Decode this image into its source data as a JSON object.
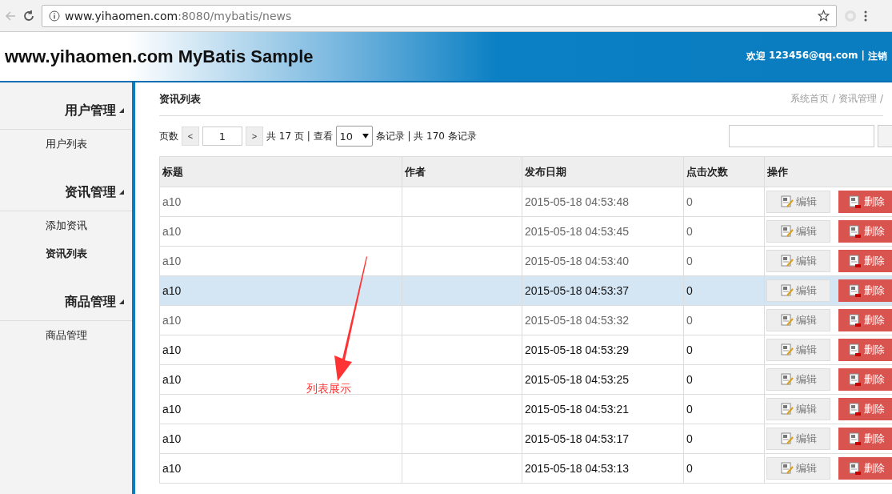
{
  "browser": {
    "url_host": "www.yihaomen.com",
    "url_rest": ":8080/mybatis/news"
  },
  "header": {
    "title": "www.yihaomen.com MyBatis Sample",
    "welcome": "欢迎",
    "user": "123456@qq.com",
    "separator": "|",
    "logout": "注销"
  },
  "sidebar": {
    "groups": [
      {
        "label": "用户管理",
        "expanded": true,
        "items": [
          {
            "label": "用户列表",
            "selected": false
          }
        ]
      },
      {
        "label": "资讯管理",
        "expanded": true,
        "items": [
          {
            "label": "添加资讯",
            "selected": false
          },
          {
            "label": "资讯列表",
            "selected": true
          }
        ]
      },
      {
        "label": "商品管理",
        "expanded": true,
        "items": [
          {
            "label": "商品管理",
            "selected": false
          }
        ]
      }
    ]
  },
  "page": {
    "title": "资讯列表",
    "breadcrumb": "系统首页 / 资讯管理 /"
  },
  "pager": {
    "label": "页数",
    "prev": "<",
    "page": "1",
    "next": ">",
    "pages_text": "共 17 页 | 查看",
    "page_size": "10",
    "records_text": "条记录 | 共 170 条记录"
  },
  "table": {
    "columns": [
      "标题",
      "作者",
      "发布日期",
      "点击次数",
      "操作"
    ],
    "rows": [
      {
        "title": "a10",
        "date": "2015-05-18 04:53:48",
        "clicks": "0",
        "dim": true,
        "selected": false,
        "edit": "编辑",
        "delete": "删除"
      },
      {
        "title": "a10",
        "date": "2015-05-18 04:53:45",
        "clicks": "0",
        "dim": true,
        "selected": false,
        "edit": "编辑",
        "delete": "删除"
      },
      {
        "title": "a10",
        "date": "2015-05-18 04:53:40",
        "clicks": "0",
        "dim": true,
        "selected": false,
        "edit": "编辑",
        "delete": "删除"
      },
      {
        "title": "a10",
        "date": "2015-05-18 04:53:37",
        "clicks": "0",
        "dim": false,
        "selected": true,
        "edit": "编辑",
        "delete": "删除"
      },
      {
        "title": "a10",
        "date": "2015-05-18 04:53:32",
        "clicks": "0",
        "dim": true,
        "selected": false,
        "edit": "编辑",
        "delete": "删除"
      },
      {
        "title": "a10",
        "date": "2015-05-18 04:53:29",
        "clicks": "0",
        "dim": false,
        "selected": false,
        "edit": "编辑",
        "delete": "删除"
      },
      {
        "title": "a10",
        "date": "2015-05-18 04:53:25",
        "clicks": "0",
        "dim": false,
        "selected": false,
        "edit": "编辑",
        "delete": "删除"
      },
      {
        "title": "a10",
        "date": "2015-05-18 04:53:21",
        "clicks": "0",
        "dim": false,
        "selected": false,
        "edit": "编辑",
        "delete": "删除"
      },
      {
        "title": "a10",
        "date": "2015-05-18 04:53:17",
        "clicks": "0",
        "dim": false,
        "selected": false,
        "edit": "编辑",
        "delete": "删除"
      },
      {
        "title": "a10",
        "date": "2015-05-18 04:53:13",
        "clicks": "0",
        "dim": false,
        "selected": false,
        "edit": "编辑",
        "delete": "删除"
      }
    ]
  },
  "annotation": {
    "text": "列表展示"
  }
}
